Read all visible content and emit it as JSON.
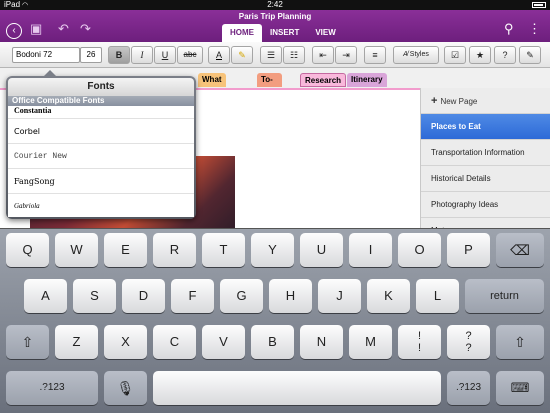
{
  "status": {
    "carrier": "iPad",
    "time": "2:42",
    "battery": "",
    "wifi": "wifi-icon"
  },
  "app": {
    "title": "Paris Trip Planning"
  },
  "ribbon_tabs": [
    "HOME",
    "INSERT",
    "VIEW"
  ],
  "toolbar": {
    "font_name": "Bodoni 72",
    "font_size": "26",
    "bold": "B",
    "italic": "I",
    "underline": "U",
    "strike": "abc",
    "font_color": "A",
    "styles": "Styles"
  },
  "section_tabs": [
    "What to Pack",
    "To-Do's",
    "Research",
    "Itinerary"
  ],
  "pages": {
    "new_page": "New Page",
    "items": [
      "Places to Eat",
      "Transportation Information",
      "Historical Details",
      "Photography Ideas",
      "Metro map"
    ]
  },
  "fonts_popover": {
    "title": "Fonts",
    "group": "Office Compatible Fonts",
    "items": [
      "Constantia",
      "Corbel",
      "Courier New",
      "FangSong",
      "Gabriola"
    ]
  },
  "keyboard": {
    "row1": [
      "Q",
      "W",
      "E",
      "R",
      "T",
      "Y",
      "U",
      "I",
      "O",
      "P"
    ],
    "row2": [
      "A",
      "S",
      "D",
      "F",
      "G",
      "H",
      "J",
      "K",
      "L"
    ],
    "return": "return",
    "row3": [
      "Z",
      "X",
      "C",
      "V",
      "B",
      "N",
      "M"
    ],
    "exclaim": "!",
    "exclaim_shift": "!",
    "question": "?",
    "question_shift": "?",
    "num_key": ".?123"
  },
  "colors": {
    "brand": "#7a2a8a",
    "page_list_selected": "#3a78e0"
  }
}
